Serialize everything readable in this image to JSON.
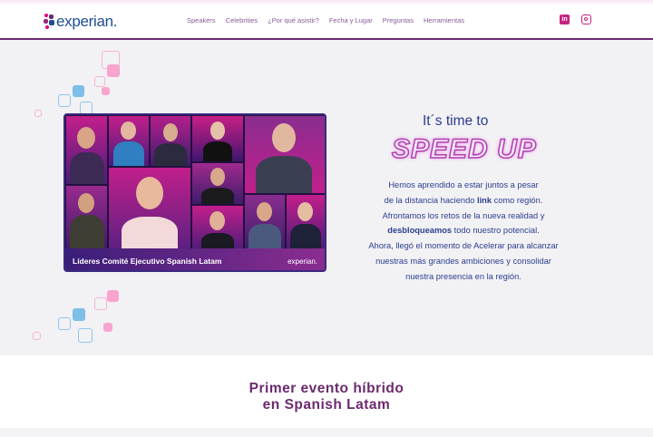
{
  "header": {
    "logo_text": "experian.",
    "nav_items": [
      "Speakers",
      "Celebrities",
      "¿Por qué asistir?",
      "Fecha y Lugar",
      "Preguntas",
      "Herramientas"
    ],
    "social": [
      {
        "icon": "linkedin-icon",
        "color": "#c4237f"
      },
      {
        "icon": "instagram-icon",
        "color": "#c4237f"
      }
    ]
  },
  "hero": {
    "panel_title": "Líderes Comité Ejecutivo Spanish Latam",
    "panel_logo": "experian.",
    "tagline": "It´s time to",
    "speed": "SPEED UP",
    "paragraph": {
      "l1": "Hemos aprendido a estar juntos a pesar",
      "l2a": "de la distancia haciendo ",
      "l2b": "link",
      "l2c": " como región.",
      "l3": "Afrontamos los retos de la nueva realidad y",
      "l4a": "desbloqueamos",
      "l4b": " todo nuestro potencial.",
      "l5": "Ahora, llegó el momento de Acelerar para alcanzar",
      "l6": "nuestras más grandes ambiciones y consolidar",
      "l7": "nuestra presencia en la región."
    }
  },
  "section": {
    "line1": "Primer evento híbrido",
    "line2": "en Spanish Latam"
  },
  "colors": {
    "brand_blue": "#1d4f91",
    "brand_purple": "#6b2a6e",
    "accent_pink": "#c4237f"
  }
}
